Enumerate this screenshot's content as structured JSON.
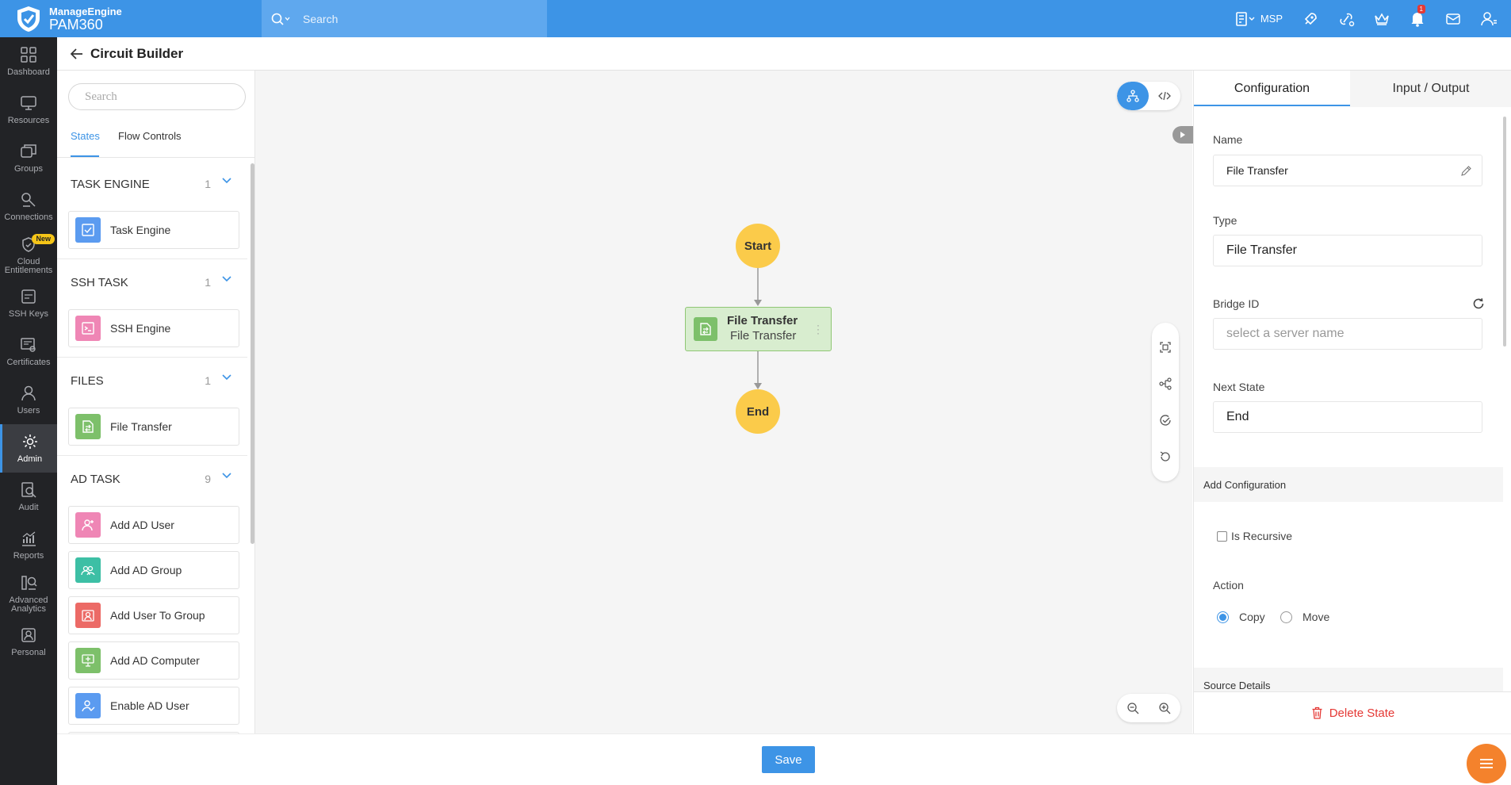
{
  "app": {
    "vendor": "ManageEngine",
    "product": "PAM360"
  },
  "topbar": {
    "search_placeholder": "Search",
    "msp_label": "MSP",
    "notification_count": "1",
    "icons": [
      "msp-icon",
      "rocket-icon",
      "link-icon",
      "crown-icon",
      "bell-icon",
      "mail-icon",
      "user-icon"
    ]
  },
  "sidenav": {
    "items": [
      {
        "label": "Dashboard",
        "icon": "dashboard-icon"
      },
      {
        "label": "Resources",
        "icon": "monitor-icon"
      },
      {
        "label": "Groups",
        "icon": "groups-icon"
      },
      {
        "label": "Connections",
        "icon": "connections-icon"
      },
      {
        "label": "Cloud Entitlements",
        "icon": "cloud-icon",
        "badge": "New"
      },
      {
        "label": "SSH Keys",
        "icon": "ssh-key-icon"
      },
      {
        "label": "Certificates",
        "icon": "certificate-icon"
      },
      {
        "label": "Users",
        "icon": "user-icon"
      },
      {
        "label": "Admin",
        "icon": "gear-icon",
        "active": true
      },
      {
        "label": "Audit",
        "icon": "audit-icon"
      },
      {
        "label": "Reports",
        "icon": "reports-icon"
      },
      {
        "label": "Advanced Analytics",
        "icon": "analytics-icon"
      },
      {
        "label": "Personal",
        "icon": "personal-icon"
      }
    ]
  },
  "page": {
    "title": "Circuit Builder"
  },
  "palette": {
    "search_placeholder": "Search",
    "tabs": [
      "States",
      "Flow Controls"
    ],
    "groups": [
      {
        "title": "TASK ENGINE",
        "count": "1",
        "items": [
          {
            "label": "Task Engine",
            "color": "#5b9bf0"
          }
        ]
      },
      {
        "title": "SSH TASK",
        "count": "1",
        "items": [
          {
            "label": "SSH Engine",
            "color": "#ef86b5"
          }
        ]
      },
      {
        "title": "FILES",
        "count": "1",
        "items": [
          {
            "label": "File Transfer",
            "color": "#7dc06a"
          }
        ]
      },
      {
        "title": "AD TASK",
        "count": "9",
        "items": [
          {
            "label": "Add AD User",
            "color": "#ef86b5"
          },
          {
            "label": "Add AD Group",
            "color": "#3dbfa5"
          },
          {
            "label": "Add User To Group",
            "color": "#ec6a66"
          },
          {
            "label": "Add AD Computer",
            "color": "#7dc06a"
          },
          {
            "label": "Enable AD User",
            "color": "#5b9bf0"
          }
        ]
      }
    ]
  },
  "canvas": {
    "start_label": "Start",
    "end_label": "End",
    "task_node": {
      "title": "File Transfer",
      "subtitle": "File Transfer"
    }
  },
  "config": {
    "tabs": [
      "Configuration",
      "Input / Output"
    ],
    "name_label": "Name",
    "name_value": "File Transfer",
    "type_label": "Type",
    "type_value": "File Transfer",
    "bridge_label": "Bridge ID",
    "bridge_placeholder": "select a server name",
    "next_label": "Next State",
    "next_value": "End",
    "add_config_label": "Add Configuration",
    "recursive_label": "Is Recursive",
    "action_label": "Action",
    "action_options": [
      "Copy",
      "Move"
    ],
    "action_selected": "Copy",
    "source_label": "Source Details",
    "delete_label": "Delete State"
  },
  "footer": {
    "save_label": "Save"
  }
}
